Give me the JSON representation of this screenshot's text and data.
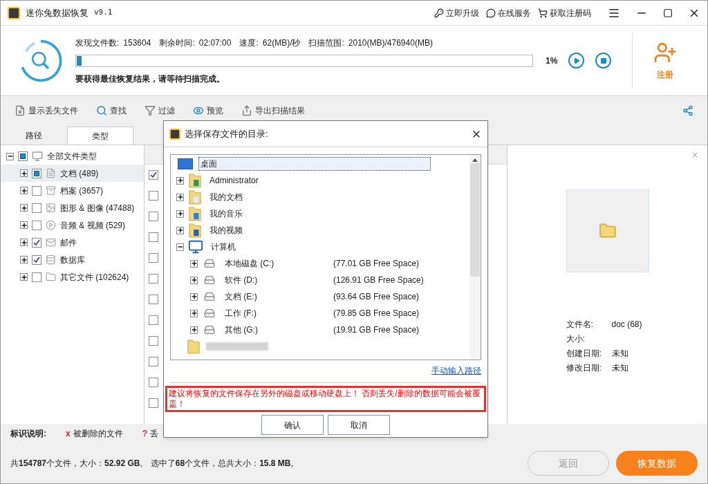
{
  "window": {
    "title": "迷你兔数据恢复",
    "version": "v9.1",
    "links": [
      {
        "kind": "upgrade",
        "label": "立即升级"
      },
      {
        "kind": "service",
        "label": "在线服务"
      },
      {
        "kind": "cart",
        "label": "获取注册码"
      }
    ]
  },
  "scan": {
    "stats": [
      {
        "label": "发现文件数:",
        "value": "153604"
      },
      {
        "label": "剩余时间:",
        "value": "02:07:00"
      },
      {
        "label": "速度:",
        "value": "62(MB)/秒"
      },
      {
        "label": "扫描范围:",
        "value": "2010(MB)/476940(MB)"
      }
    ],
    "level": 0.01,
    "percent": "1%",
    "hint": "要获得最佳恢复结果，请等待扫描完成。",
    "register": "注册"
  },
  "toolbar": [
    {
      "kind": "show-lost",
      "label": "显示丢失文件"
    },
    {
      "kind": "find",
      "label": "查找"
    },
    {
      "kind": "filter",
      "label": "过滤"
    },
    {
      "kind": "preview",
      "label": "预览"
    },
    {
      "kind": "export",
      "label": "导出扫描结果"
    }
  ],
  "tabs": [
    {
      "label": "路径",
      "selected": false
    },
    {
      "label": "类型",
      "selected": true
    }
  ],
  "tree": {
    "label": "全部文件类型",
    "checked": false,
    "partial": true,
    "expanded": true,
    "selected": false,
    "children": [
      {
        "kind": "doc",
        "label": "文档 (489)",
        "checked": false,
        "partial": true,
        "selected": true
      },
      {
        "kind": "archive",
        "label": "档案 (3657)",
        "checked": false,
        "partial": false,
        "selected": false
      },
      {
        "kind": "image",
        "label": "图形 & 图像 (47488)",
        "checked": false,
        "partial": false,
        "selected": false
      },
      {
        "kind": "media",
        "label": "音频 & 视频 (529)",
        "checked": false,
        "partial": false,
        "selected": false
      },
      {
        "kind": "mail",
        "label": "邮件",
        "checked": true,
        "partial": false,
        "selected": false
      },
      {
        "kind": "database",
        "label": "数据库",
        "checked": true,
        "partial": false,
        "selected": false
      },
      {
        "kind": "other",
        "label": "其它文件 (102624)",
        "checked": false,
        "partial": false,
        "selected": false
      }
    ]
  },
  "file_rows": [
    {
      "checked": true
    },
    {
      "checked": false
    },
    {
      "checked": false
    },
    {
      "checked": false
    },
    {
      "checked": false
    },
    {
      "checked": false
    },
    {
      "checked": false
    },
    {
      "checked": false
    },
    {
      "checked": false
    },
    {
      "checked": false
    },
    {
      "checked": false
    },
    {
      "checked": false
    }
  ],
  "preview": {
    "fields": [
      {
        "label": "文件名:",
        "value": "doc (68)"
      },
      {
        "label": "大小:"
      },
      {
        "label": "创建日期:",
        "value": "未知"
      },
      {
        "label": "修改日期:",
        "value": "未知"
      }
    ]
  },
  "legend": {
    "title": "标识说明:",
    "items": [
      {
        "mark": "x",
        "label": "被删除的文件"
      },
      {
        "mark": "?",
        "label": "丢"
      }
    ]
  },
  "status": "共**154787**个文件，大小：**52.92 GB**。 选中了**68**个文件，总共大小：**15.8 MB**。",
  "buttons": [
    {
      "kind": "back",
      "label": "返回",
      "disabled": true
    },
    {
      "kind": "recover",
      "label": "恢复数据",
      "disabled": false
    }
  ],
  "dialog": {
    "title": "选择保存文件的目录:",
    "tree": {
      "kind": "desktop",
      "label": "桌面",
      "selected": true,
      "children": [
        {
          "kind": "user",
          "label": "Administrator",
          "expanded": false,
          "selected": false
        },
        {
          "kind": "docs",
          "label": "我的文档",
          "expanded": false,
          "selected": false
        },
        {
          "kind": "music",
          "label": "我的音乐",
          "expanded": false,
          "selected": false
        },
        {
          "kind": "video",
          "label": "我的视频",
          "expanded": false,
          "selected": false
        },
        {
          "kind": "computer",
          "label": "计算机",
          "expanded": true,
          "selected": false,
          "children": [
            {
              "kind": "drive",
              "label": "本地磁盘 (C:)",
              "free": "(77.01 GB Free Space)",
              "expanded": false,
              "selected": false
            },
            {
              "kind": "drive",
              "label": "软件 (D:)",
              "free": "(126.91 GB Free Space)",
              "expanded": false,
              "selected": false
            },
            {
              "kind": "drive",
              "label": "文档 (E:)",
              "free": "(93.64 GB Free Space)",
              "expanded": false,
              "selected": false
            },
            {
              "kind": "drive",
              "label": "工作 (F:)",
              "free": "(79.85 GB Free Space)",
              "expanded": false,
              "selected": false
            },
            {
              "kind": "drive",
              "label": "其他 (G:)",
              "free": "(19.91 GB Free Space)",
              "expanded": false,
              "selected": false
            }
          ]
        },
        {
          "kind": "blurred"
        }
      ]
    },
    "manual_link": "手动输入路径",
    "warning": "建议将恢复的文件保存在另外的磁盘或移动硬盘上！ 否则丢失/删除的数据可能会被覆盖！",
    "buttons": [
      "确认",
      "取消"
    ]
  }
}
